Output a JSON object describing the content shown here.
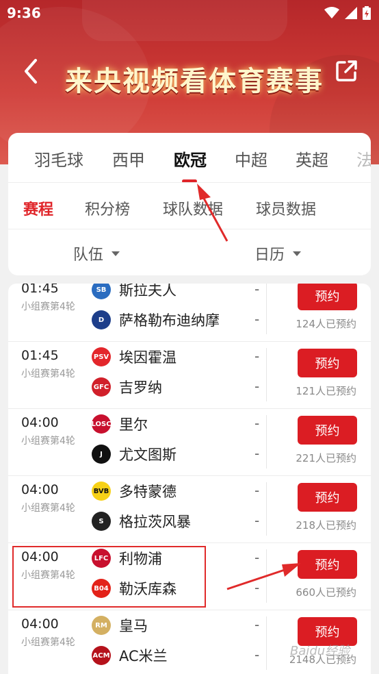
{
  "status_bar": {
    "time": "9:36"
  },
  "header": {
    "title": "来央视频看体育赛事"
  },
  "tabs": [
    {
      "label": "羽毛球"
    },
    {
      "label": "西甲"
    },
    {
      "label": "欧冠"
    },
    {
      "label": "中超"
    },
    {
      "label": "英超"
    },
    {
      "label": "法"
    }
  ],
  "active_tab": "欧冠",
  "subtabs": [
    {
      "label": "赛程"
    },
    {
      "label": "积分榜"
    },
    {
      "label": "球队数据"
    },
    {
      "label": "球员数据"
    }
  ],
  "filters": {
    "team": "队伍",
    "calendar": "日历"
  },
  "matches": [
    {
      "time": "01:45",
      "stage": "小组赛第4轮",
      "home": "斯拉夫人",
      "away": "萨格勒布迪纳摩",
      "home_score": "-",
      "away_score": "-",
      "button": "预约",
      "count": "124人已预约"
    },
    {
      "time": "01:45",
      "stage": "小组赛第4轮",
      "home": "埃因霍温",
      "away": "吉罗纳",
      "home_score": "-",
      "away_score": "-",
      "button": "预约",
      "count": "121人已预约"
    },
    {
      "time": "04:00",
      "stage": "小组赛第4轮",
      "home": "里尔",
      "away": "尤文图斯",
      "home_score": "-",
      "away_score": "-",
      "button": "预约",
      "count": "221人已预约"
    },
    {
      "time": "04:00",
      "stage": "小组赛第4轮",
      "home": "多特蒙德",
      "away": "格拉茨风暴",
      "home_score": "-",
      "away_score": "-",
      "button": "预约",
      "count": "218人已预约"
    },
    {
      "time": "04:00",
      "stage": "小组赛第4轮",
      "home": "利物浦",
      "away": "勒沃库森",
      "home_score": "-",
      "away_score": "-",
      "button": "预约",
      "count": "660人已预约"
    },
    {
      "time": "04:00",
      "stage": "小组赛第4轮",
      "home": "皇马",
      "away": "AC米兰",
      "home_score": "-",
      "away_score": "-",
      "button": "预约",
      "count": "2148人已预约"
    }
  ],
  "badges": {
    "home": [
      {
        "text": "SB",
        "color": "#2a6cc0"
      },
      {
        "text": "PSV",
        "color": "#e3262b"
      },
      {
        "text": "LOSC",
        "color": "#c8102e"
      },
      {
        "text": "BVB",
        "color": "#f7d117"
      },
      {
        "text": "LFC",
        "color": "#c8102e"
      },
      {
        "text": "RM",
        "color": "#d4b062"
      }
    ],
    "away": [
      {
        "text": "D",
        "color": "#1d3e8a"
      },
      {
        "text": "GFC",
        "color": "#d1202a"
      },
      {
        "text": "J",
        "color": "#111111"
      },
      {
        "text": "S",
        "color": "#222222"
      },
      {
        "text": "B04",
        "color": "#e32219"
      },
      {
        "text": "ACM",
        "color": "#b5121b"
      }
    ]
  },
  "watermark": "Baidu经验",
  "colors": {
    "brand_red": "#db1d23",
    "header_red": "#c8322f"
  }
}
